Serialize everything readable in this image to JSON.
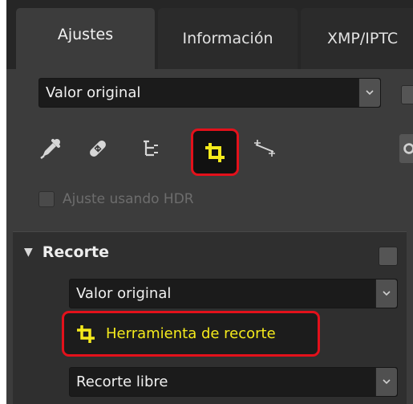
{
  "tabs": [
    {
      "label": "Ajustes"
    },
    {
      "label": "Información"
    },
    {
      "label": "XMP/IPTC"
    }
  ],
  "preset_select": {
    "value": "Valor original"
  },
  "toolbar": {
    "icons": [
      "color-picker-icon",
      "healing-bandage-icon",
      "tree-list-icon",
      "crop-icon",
      "straighten-icon",
      "gear-icon"
    ],
    "active_tool": "crop-icon"
  },
  "hdr": {
    "label": "Ajuste usando HDR",
    "checked": false
  },
  "crop_section": {
    "title": "Recorte",
    "preset_value": "Valor original",
    "tool_button_label": "Herramienta de recorte",
    "ratio_value": "Recorte libre"
  },
  "colors": {
    "highlight": "#e3111b",
    "crop_yellow": "#f4ea1c",
    "panel_bg": "#3c3c3c"
  }
}
